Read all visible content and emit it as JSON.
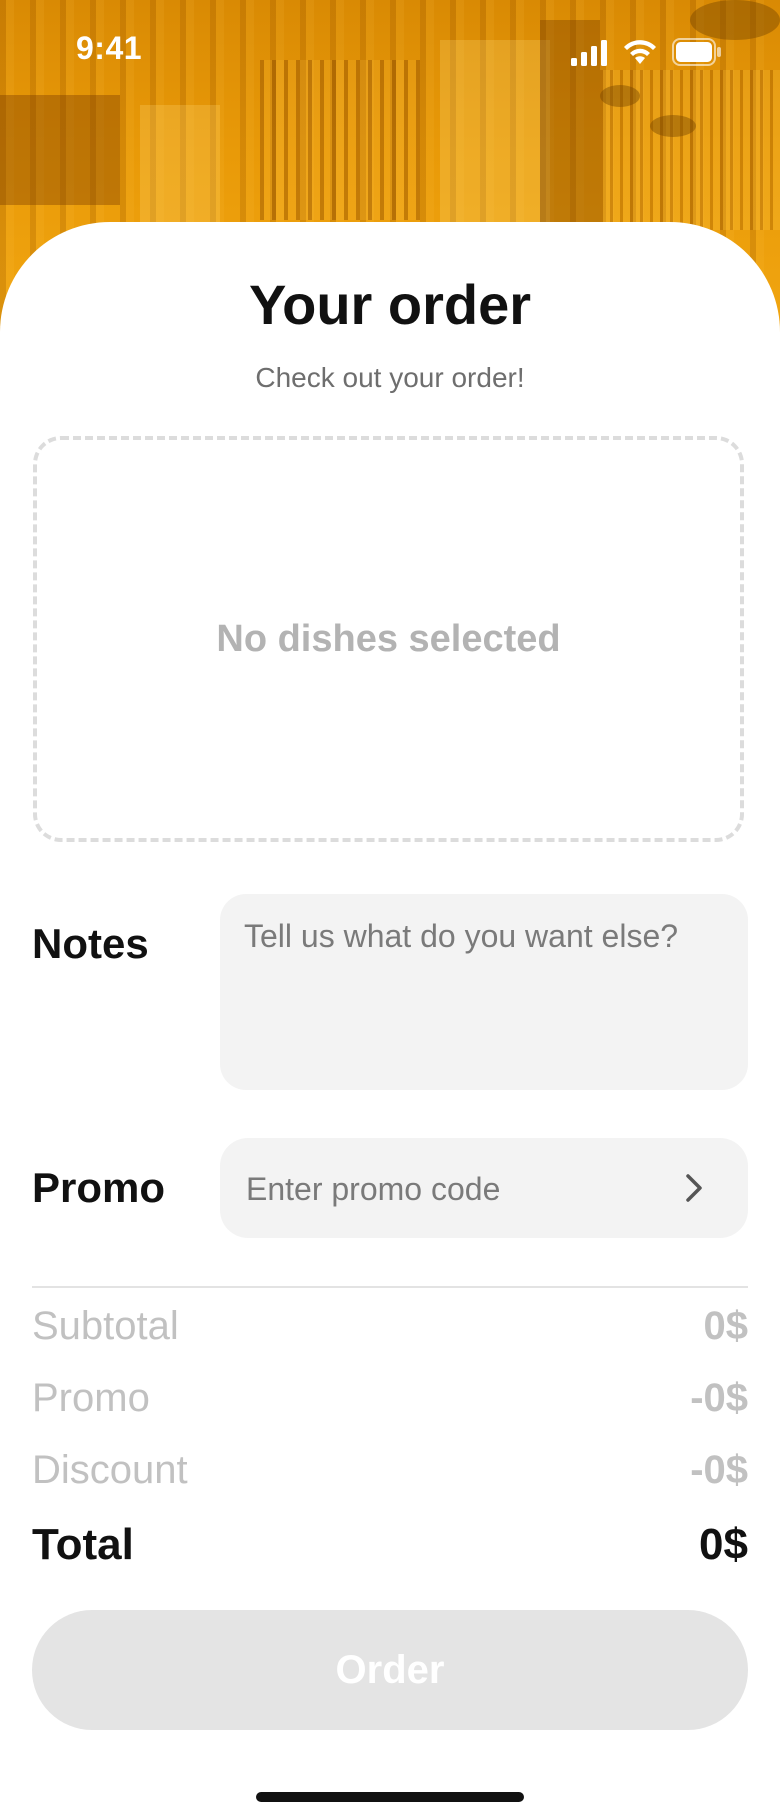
{
  "status_bar": {
    "time": "9:41"
  },
  "page": {
    "title": "Your order",
    "subtitle": "Check out your order!",
    "empty_dishes": "No dishes selected"
  },
  "notes": {
    "label": "Notes",
    "placeholder": "Tell us what do you want else?",
    "value": ""
  },
  "promo": {
    "label": "Promo",
    "placeholder": "Enter promo code",
    "value": "",
    "icon": "chevron-right-icon"
  },
  "summary": {
    "subtotal": {
      "label": "Subtotal",
      "value": "0$"
    },
    "promo": {
      "label": "Promo",
      "value": "-0$"
    },
    "discount": {
      "label": "Discount",
      "value": "-0$"
    },
    "total": {
      "label": "Total",
      "value": "0$"
    }
  },
  "actions": {
    "order_label": "Order"
  },
  "colors": {
    "accent_orange": "#e99a08",
    "button_disabled": "#e4e4e4",
    "field_background": "#f3f3f3"
  }
}
